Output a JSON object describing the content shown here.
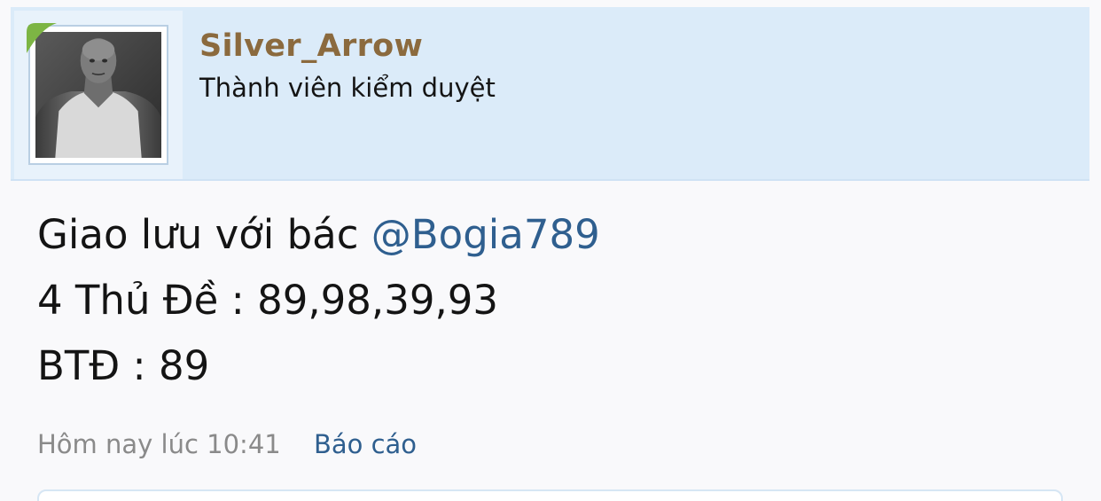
{
  "post": {
    "author": {
      "username": "Silver_Arrow",
      "title": "Thành viên kiểm duyệt"
    },
    "message": {
      "line1_text": "Giao lưu với bác ",
      "line1_mention": "@Bogia789",
      "line2": "4 Thủ Đề : 89,98,39,93",
      "line3": "BTĐ : 89"
    },
    "meta": {
      "timestamp": "Hôm nay lúc 10:41",
      "report_label": "Báo cáo"
    }
  },
  "colors": {
    "user_bar_bg": "#dbebf9",
    "username": "#8b6a3e",
    "link": "#2f5f8f",
    "online_indicator": "#7db544"
  }
}
